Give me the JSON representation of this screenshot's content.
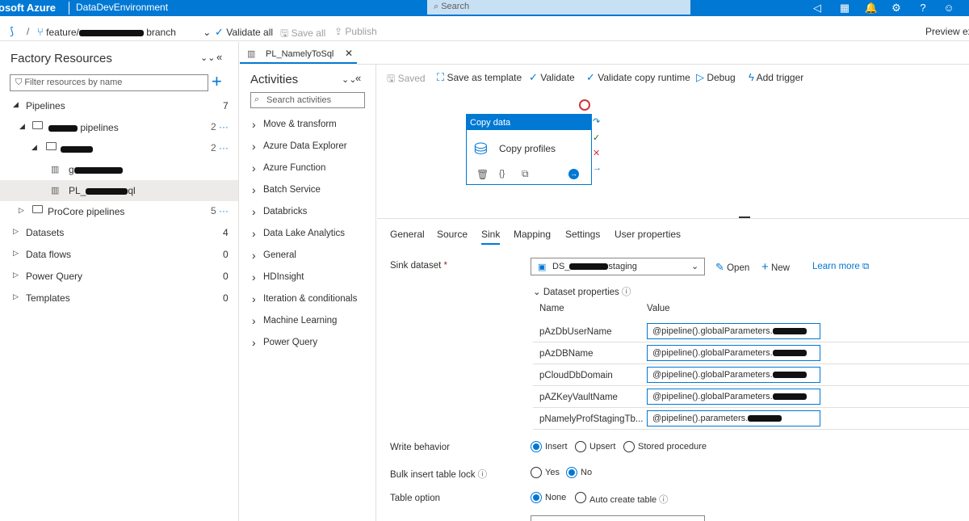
{
  "topbar": {
    "brand": "osoft Azure",
    "environment": "DataDevEnvironment",
    "search_placeholder": "Search"
  },
  "cmdbar": {
    "branch_prefix": "feature/",
    "branch_suffix": "branch",
    "validate_all": "Validate all",
    "save_all": "Save all",
    "publish": "Publish",
    "preview": "Preview exp"
  },
  "factory": {
    "title": "Factory Resources",
    "filter_placeholder": "Filter resources by name",
    "pipelines": {
      "label": "Pipelines",
      "count": "7"
    },
    "folder1": {
      "label": "pipelines",
      "count": "2"
    },
    "folder2": {
      "count": "2"
    },
    "pl1_prefix": "g",
    "pl2_prefix": "PL_",
    "pl2_suffix": "ql",
    "procore": {
      "label": "ProCore pipelines",
      "count": "5"
    },
    "datasets": {
      "label": "Datasets",
      "count": "4"
    },
    "dataflows": {
      "label": "Data flows",
      "count": "0"
    },
    "powerquery": {
      "label": "Power Query",
      "count": "0"
    },
    "templates": {
      "label": "Templates",
      "count": "0"
    }
  },
  "tab": {
    "title": "PL_NamelyToSql"
  },
  "activities": {
    "title": "Activities",
    "search_placeholder": "Search activities",
    "items": [
      "Move & transform",
      "Azure Data Explorer",
      "Azure Function",
      "Batch Service",
      "Databricks",
      "Data Lake Analytics",
      "General",
      "HDInsight",
      "Iteration & conditionals",
      "Machine Learning",
      "Power Query"
    ]
  },
  "toolbar": {
    "saved": "Saved",
    "save_template": "Save as template",
    "validate": "Validate",
    "validate_runtime": "Validate copy runtime",
    "debug": "Debug",
    "add_trigger": "Add trigger"
  },
  "node": {
    "header": "Copy data",
    "name": "Copy profiles"
  },
  "props": {
    "tabs": [
      "General",
      "Source",
      "Sink",
      "Mapping",
      "Settings",
      "User properties"
    ],
    "sink_dataset_label": "Sink dataset",
    "dataset_prefix": "DS_",
    "dataset_suffix": "staging",
    "open": "Open",
    "new": "New",
    "learn_more": "Learn more",
    "dataset_properties": "Dataset properties",
    "col_name": "Name",
    "col_value": "Value",
    "rows": [
      {
        "name": "pAzDbUserName",
        "value": "@pipeline().globalParameters."
      },
      {
        "name": "pAzDBName",
        "value": "@pipeline().globalParameters."
      },
      {
        "name": "pCloudDbDomain",
        "value": "@pipeline().globalParameters."
      },
      {
        "name": "pAZKeyVaultName",
        "value": "@pipeline().globalParameters."
      },
      {
        "name": "pNamelyProfStagingTb...",
        "value": "@pipeline().parameters."
      }
    ],
    "write_behavior": "Write behavior",
    "insert": "Insert",
    "upsert": "Upsert",
    "stored_procedure": "Stored procedure",
    "bulk_lock": "Bulk insert table lock",
    "yes": "Yes",
    "no": "No",
    "table_option": "Table option",
    "none": "None",
    "auto_create": "Auto create table"
  }
}
